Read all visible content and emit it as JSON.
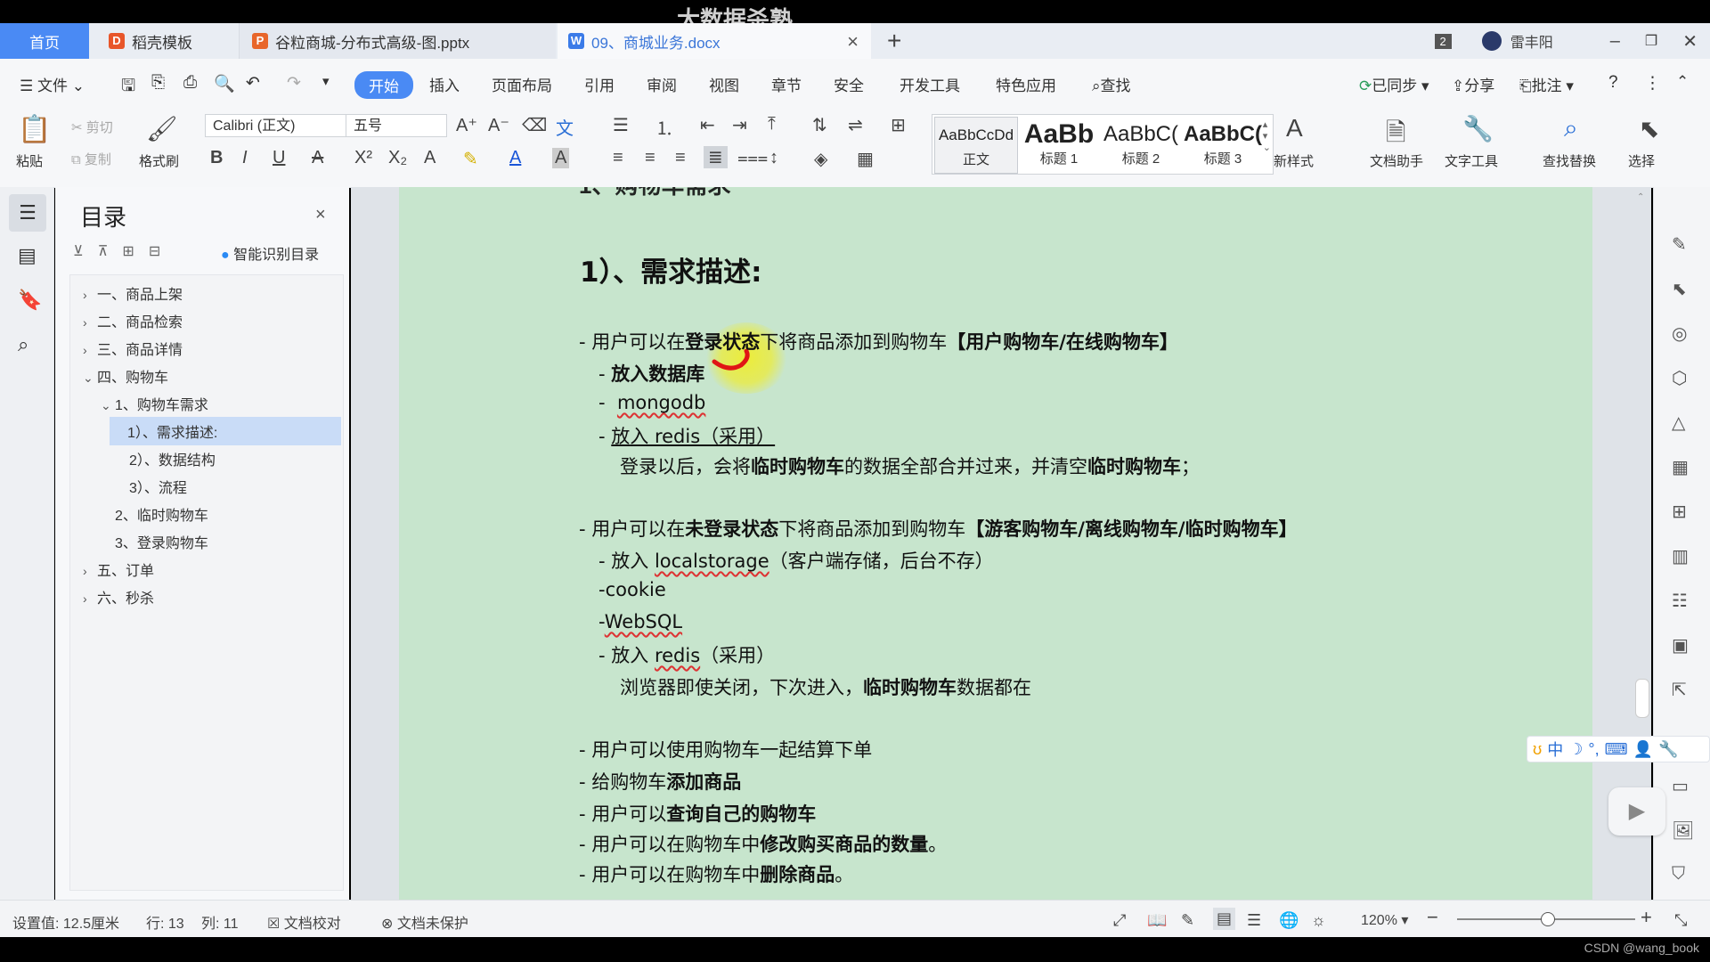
{
  "watermark": "大数据杀熟",
  "tabs": {
    "home": "首页",
    "t1": "稻壳模板",
    "t2": "谷粒商城-分布式高级-图.pptx",
    "t3": "09、商城业务.docx",
    "add": "+",
    "badge": "2",
    "user": "雷丰阳"
  },
  "menu": {
    "file": "文件",
    "items": [
      "开始",
      "插入",
      "页面布局",
      "引用",
      "审阅",
      "视图",
      "章节",
      "安全",
      "开发工具",
      "特色应用"
    ],
    "search": "查找",
    "sync": "已同步",
    "share": "分享",
    "comment": "批注"
  },
  "ribbon": {
    "paste": "粘贴",
    "cut": "剪切",
    "copy": "复制",
    "format_painter": "格式刷",
    "font_name": "Calibri (正文)",
    "font_size": "五号",
    "styles": [
      {
        "preview": "AaBbCcDd",
        "label": "正文"
      },
      {
        "preview": "AaBb",
        "label": "标题 1"
      },
      {
        "preview": "AaBbC(",
        "label": "标题 2"
      },
      {
        "preview": "AaBbC(",
        "label": "标题 3"
      }
    ],
    "new_style": "新样式",
    "doc_helper": "文档助手",
    "text_tools": "文字工具",
    "find_replace": "查找替换",
    "select": "选择"
  },
  "toc": {
    "title": "目录",
    "smart": "智能识别目录",
    "items": [
      {
        "label": "一、商品上架",
        "level": 0,
        "caret": "›"
      },
      {
        "label": "二、商品检索",
        "level": 0,
        "caret": "›"
      },
      {
        "label": "三、商品详情",
        "level": 0,
        "caret": "›"
      },
      {
        "label": "四、购物车",
        "level": 0,
        "caret": "⌄"
      },
      {
        "label": "1、购物车需求",
        "level": 1,
        "caret": "⌄"
      },
      {
        "label": "1）、需求描述:",
        "level": 2,
        "caret": "",
        "active": true
      },
      {
        "label": "2）、数据结构",
        "level": 2,
        "caret": ""
      },
      {
        "label": "3）、流程",
        "level": 2,
        "caret": ""
      },
      {
        "label": "2、临时购物车",
        "level": 1,
        "caret": ""
      },
      {
        "label": "3、登录购物车",
        "level": 1,
        "caret": ""
      },
      {
        "label": "五、订单",
        "level": 0,
        "caret": "›"
      },
      {
        "label": "六、秒杀",
        "level": 0,
        "caret": "›"
      }
    ]
  },
  "doc": {
    "heading": "1）、需求描述:",
    "l1_pre": "- 用户可以在",
    "l1_b": "登录状态",
    "l1_mid": "下将商品添加到购物车",
    "l1_tag": "【用户购物车/在线购物车】",
    "l2": "放入数据库",
    "l3": "mongodb",
    "l4": "放入 redis（采用）",
    "l5_pre": "登录以后，会将",
    "l5_b1": "临时购物车",
    "l5_mid": "的数据全部合并过来，并清空",
    "l5_b2": "临时购物车",
    "l5_end": "；",
    "l6_pre": "- 用户可以在",
    "l6_b": "未登录状态",
    "l6_mid": "下将商品添加到购物车",
    "l6_tag": "【游客购物车/离线购物车/临时购物车】",
    "l7_pre": "放入 ",
    "l7_w": "localstorage",
    "l7_end": "（客户端存储，后台不存）",
    "l8": "cookie",
    "l9": "WebSQL",
    "l10_pre": "放入 ",
    "l10_w": "redis",
    "l10_end": "（采用）",
    "l11_pre": "浏览器即使关闭，下次进入，",
    "l11_b": "临时购物车",
    "l11_end": "数据都在",
    "l12": "- 用户可以使用购物车一起结算下单",
    "l13_pre": "- 给购物车",
    "l13_b": "添加商品",
    "l14_pre": "- 用户可以",
    "l14_b": "查询自己的购物车",
    "l15_pre": "- 用户可以在购物车中",
    "l15_b": "修改购买商品的数量",
    "l15_end": "。",
    "l16_pre": "- 用户可以在购物车中",
    "l16_b": "删除商品",
    "l16_end": "。"
  },
  "status": {
    "setting": "设置值: 12.5厘米",
    "row": "行: 13",
    "col": "列: 11",
    "proof": "文档校对",
    "protect": "文档未保护",
    "zoom": "120%"
  },
  "ime": "中",
  "csdn": "CSDN @wang_book"
}
